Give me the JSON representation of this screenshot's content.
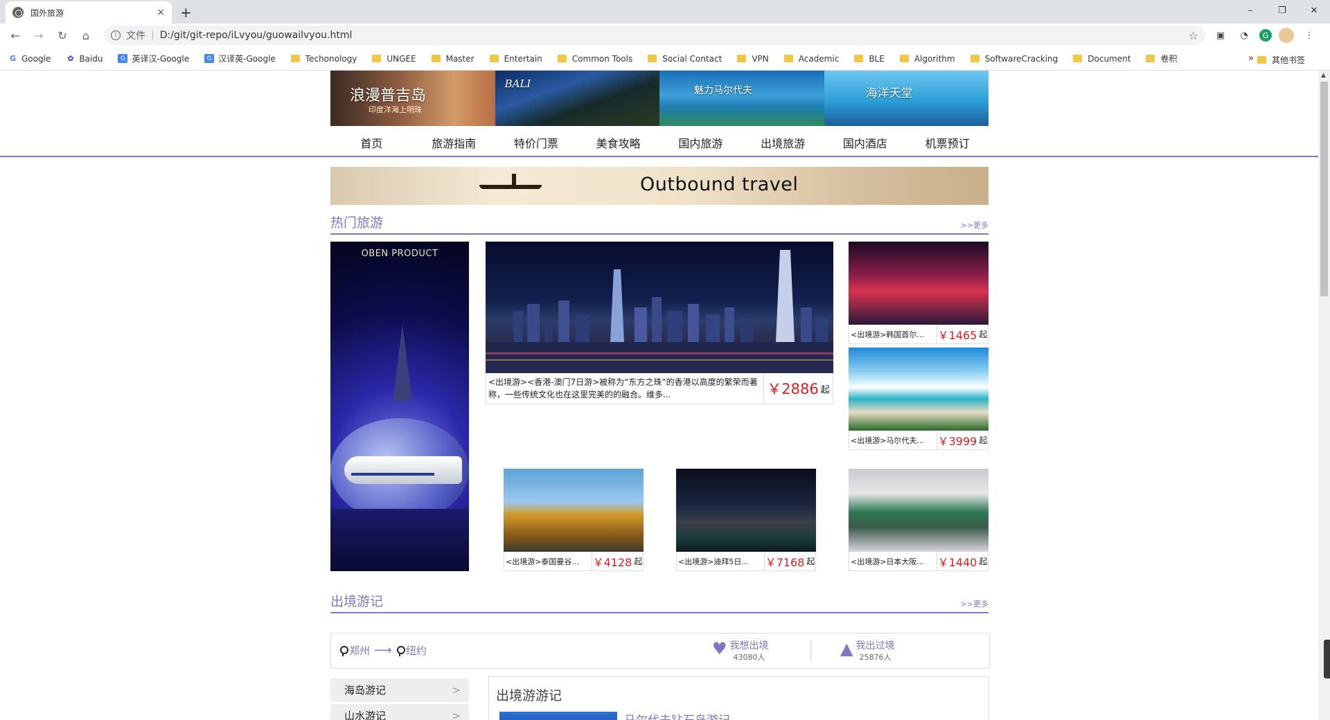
{
  "browser": {
    "tab_title": "国外旅游",
    "tab_close": "×",
    "new_tab": "+",
    "win_min": "–",
    "win_max": "❐",
    "win_close": "✕",
    "scheme_label": "文件",
    "url": "D:/git/git-repo/iLvyou/guowailvyou.html",
    "bookmarks": [
      "Google",
      "Baidu",
      "英译汉-Google",
      "汉译英-Google",
      "Techonology",
      "UNGEE",
      "Master",
      "Entertain",
      "Common Tools",
      "Social Contact",
      "VPN",
      "Academic",
      "BLE",
      "Algorithm",
      "SoftwareCracking",
      "Document",
      "卷积"
    ],
    "bookmarks_more": "»",
    "other_bookmarks": "其他书签"
  },
  "banner": {
    "b1_title": "浪漫普吉岛",
    "b1_sub": "印度洋海上明珠",
    "b2_title": "BALI",
    "b3_title": "魅力马尔代夫",
    "b4_title": "海洋天堂"
  },
  "nav": [
    "首页",
    "旅游指南",
    "特价门票",
    "美食攻略",
    "国内旅游",
    "出境旅游",
    "国内酒店",
    "机票预订"
  ],
  "outbound_banner": "Outbound travel",
  "hot": {
    "title": "热门旅游",
    "more": ">>更多",
    "poster_title": "OBEN PRODUCT",
    "featured": {
      "text": "<出境游><香港-澳门7日游>被称为“东方之珠”的香港以高度的繁荣而著称，一些传统文化也在这里完美的的融合。维多...",
      "price": "￥2886",
      "unit": "起"
    },
    "items": [
      {
        "text": "<出境游>韩国首尔...",
        "price": "￥1465",
        "unit": "起"
      },
      {
        "text": "<出境游>马尔代夫...",
        "price": "￥3999",
        "unit": "起"
      },
      {
        "text": "<出境游>泰国曼谷...",
        "price": "￥4128",
        "unit": "起"
      },
      {
        "text": "<出境游>迪拜5日...",
        "price": "￥7168",
        "unit": "起"
      },
      {
        "text": "<出境游>日本大阪...",
        "price": "￥1440",
        "unit": "起"
      }
    ]
  },
  "journal": {
    "title": "出境游记",
    "more": ">>更多",
    "from": "郑州",
    "to": "纽约",
    "want_label": "我想出境",
    "want_count": "43080人",
    "been_label": "我出过境",
    "been_count": "25876人",
    "categories": [
      "海岛游记",
      "山水游记"
    ],
    "panel_title": "出境游游记",
    "first_link": "马尔代夫钻石岛游记"
  },
  "colors": {
    "accent": "#7b79c5",
    "price": "#e21c1c"
  }
}
